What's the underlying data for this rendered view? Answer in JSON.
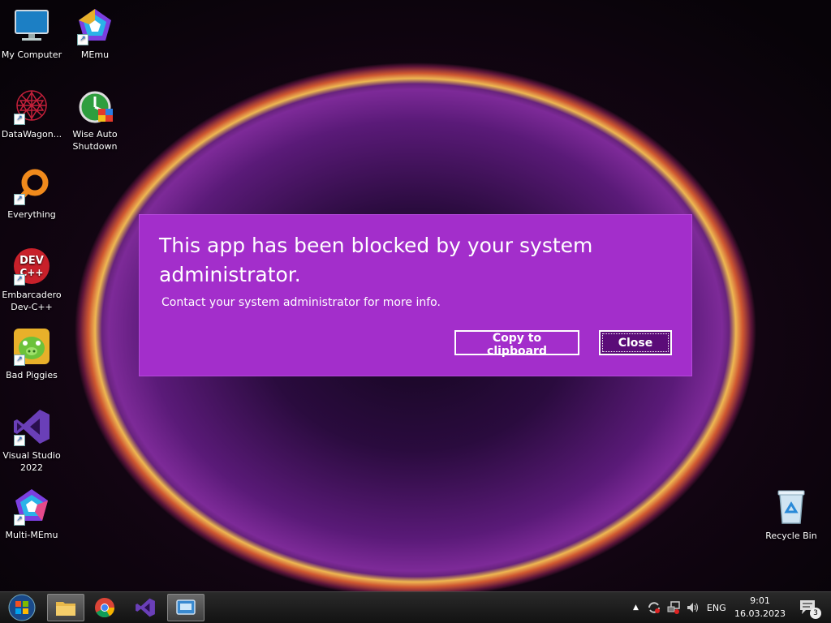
{
  "desktop": {
    "icons": [
      {
        "label": "My Computer"
      },
      {
        "label": "MEmu"
      },
      {
        "label": "DataWagon..."
      },
      {
        "label": "Wise Auto Shutdown"
      },
      {
        "label": "Everything"
      },
      {
        "label": "Embarcadero Dev-C++"
      },
      {
        "label": "Bad Piggies"
      },
      {
        "label": "Visual Studio 2022"
      },
      {
        "label": "Multi-MEmu"
      },
      {
        "label": "Recycle Bin"
      }
    ]
  },
  "dialog": {
    "title": "This app has been blocked by your system administrator.",
    "message": "Contact your system administrator for more info.",
    "copy_label": "Copy to clipboard",
    "close_label": "Close",
    "background_color": "#a32ecb"
  },
  "taskbar": {
    "apps": [
      {
        "icon": "file-explorer-icon"
      },
      {
        "icon": "chrome-icon"
      },
      {
        "icon": "visual-studio-icon"
      },
      {
        "icon": "app-window-icon"
      }
    ],
    "language": "ENG",
    "time": "9:01",
    "date": "16.03.2023",
    "notification_count": "3"
  }
}
